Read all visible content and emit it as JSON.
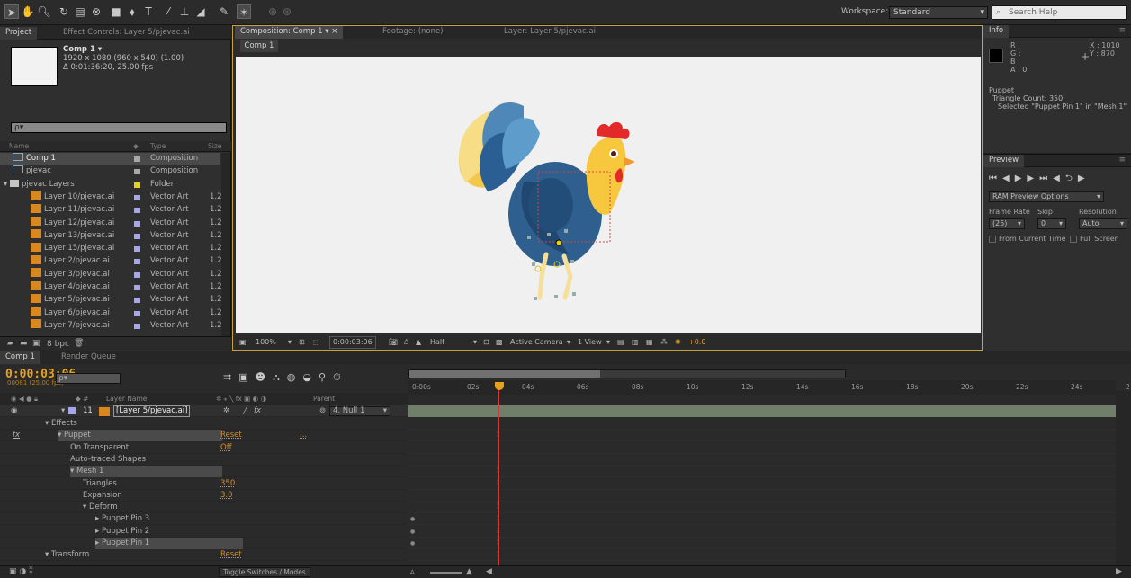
{
  "toolbar": {
    "workspace_label": "Workspace:",
    "workspace_value": "Standard",
    "search_placeholder": "Search Help"
  },
  "project_panel": {
    "tabs": [
      "Project",
      "Effect Controls: Layer 5/pjevac.ai"
    ],
    "comp_name": "Comp 1 ▾",
    "comp_size": "1920 x 1080  (960 x 540) (1.00)",
    "comp_duration": "Δ 0:01:36:20, 25.00 fps",
    "search_placeholder": "ρ▾",
    "columns": [
      "Name",
      "Type",
      "Size"
    ],
    "items": [
      {
        "name": "Comp 1",
        "type": "Composition",
        "size": "",
        "icon": "composition-icon",
        "swatch": "#a8a8a8"
      },
      {
        "name": "pjevac",
        "type": "Composition",
        "size": "",
        "icon": "composition-icon",
        "swatch": "#a8a8a8"
      },
      {
        "name": "pjevac Layers",
        "type": "Folder",
        "size": "",
        "icon": "folder-icon",
        "swatch": "#e8d020"
      },
      {
        "name": "Layer 10/pjevac.ai",
        "type": "Vector Art",
        "size": "1.2",
        "icon": "ai-file-icon",
        "swatch": "#a6a6ea"
      },
      {
        "name": "Layer 11/pjevac.ai",
        "type": "Vector Art",
        "size": "1.2",
        "icon": "ai-file-icon",
        "swatch": "#a6a6ea"
      },
      {
        "name": "Layer 12/pjevac.ai",
        "type": "Vector Art",
        "size": "1.2",
        "icon": "ai-file-icon",
        "swatch": "#a6a6ea"
      },
      {
        "name": "Layer 13/pjevac.ai",
        "type": "Vector Art",
        "size": "1.2",
        "icon": "ai-file-icon",
        "swatch": "#a6a6ea"
      },
      {
        "name": "Layer 15/pjevac.ai",
        "type": "Vector Art",
        "size": "1.2",
        "icon": "ai-file-icon",
        "swatch": "#a6a6ea"
      },
      {
        "name": "Layer 2/pjevac.ai",
        "type": "Vector Art",
        "size": "1.2",
        "icon": "ai-file-icon",
        "swatch": "#a6a6ea"
      },
      {
        "name": "Layer 3/pjevac.ai",
        "type": "Vector Art",
        "size": "1.2",
        "icon": "ai-file-icon",
        "swatch": "#a6a6ea"
      },
      {
        "name": "Layer 4/pjevac.ai",
        "type": "Vector Art",
        "size": "1.2",
        "icon": "ai-file-icon",
        "swatch": "#a6a6ea"
      },
      {
        "name": "Layer 5/pjevac.ai",
        "type": "Vector Art",
        "size": "1.2",
        "icon": "ai-file-icon",
        "swatch": "#a6a6ea"
      },
      {
        "name": "Layer 6/pjevac.ai",
        "type": "Vector Art",
        "size": "1.2",
        "icon": "ai-file-icon",
        "swatch": "#a6a6ea"
      },
      {
        "name": "Layer 7/pjevac.ai",
        "type": "Vector Art",
        "size": "1.2",
        "icon": "ai-file-icon",
        "swatch": "#a6a6ea"
      }
    ],
    "footer_bpc": "8 bpc"
  },
  "composition_panel": {
    "tabs": [
      "Composition: Comp 1",
      "Footage: (none)",
      "Layer: Layer 5/pjevac.ai"
    ],
    "comp_tab": "Comp 1",
    "zoom": "100%",
    "timecode": "0:00:03:06",
    "resolution": "Half",
    "camera": "Active Camera",
    "views": "1 View",
    "exposure": "+0.0"
  },
  "info_panel": {
    "tab": "Info",
    "r": "R :",
    "g": "G :",
    "b": "B :",
    "a": "A : 0",
    "x": "X : 1010",
    "y": "Y : 870",
    "line1": "Puppet",
    "line2": "Triangle Count: 350",
    "line3": "Selected \"Puppet Pin 1\" in \"Mesh 1\""
  },
  "preview_panel": {
    "tab": "Preview",
    "ram_options": "RAM Preview Options",
    "frame_rate_label": "Frame Rate",
    "skip_label": "Skip",
    "resolution_label": "Resolution",
    "frame_rate": "(25)",
    "skip": "0",
    "resolution": "Auto",
    "from_current": "From Current Time",
    "full_screen": "Full Screen"
  },
  "timeline": {
    "tabs": [
      "Comp 1",
      "Render Queue"
    ],
    "timecode": "0:00:03:06",
    "fps": "00081 (25.00 fps)",
    "search_placeholder": "ρ▾",
    "col_layer_name": "Layer Name",
    "col_parent": "Parent",
    "ticks": [
      "0:00s",
      "02s",
      "04s",
      "06s",
      "08s",
      "10s",
      "12s",
      "14s",
      "16s",
      "18s",
      "20s",
      "22s",
      "24s",
      "2"
    ],
    "layer_num": "11",
    "layer_name": "[Layer 5/pjevac.ai]",
    "parent": "4. Null 1",
    "props": [
      {
        "label": "Effects",
        "indent": 2,
        "value": ""
      },
      {
        "label": "Puppet",
        "indent": 3,
        "value": "Reset",
        "extra": "..."
      },
      {
        "label": "On Transparent",
        "indent": 4,
        "value": "Off"
      },
      {
        "label": "Auto-traced Shapes",
        "indent": 4,
        "value": ""
      },
      {
        "label": "Mesh 1",
        "indent": 4,
        "value": ""
      },
      {
        "label": "Triangles",
        "indent": 5,
        "value": "350"
      },
      {
        "label": "Expansion",
        "indent": 5,
        "value": "3.0"
      },
      {
        "label": "Deform",
        "indent": 5,
        "value": ""
      },
      {
        "label": "Puppet Pin 3",
        "indent": 6,
        "value": ""
      },
      {
        "label": "Puppet Pin 2",
        "indent": 6,
        "value": ""
      },
      {
        "label": "Puppet Pin 1",
        "indent": 6,
        "value": ""
      },
      {
        "label": "Transform",
        "indent": 2,
        "value": "Reset"
      }
    ],
    "toggle_label": "Toggle Switches / Modes"
  }
}
